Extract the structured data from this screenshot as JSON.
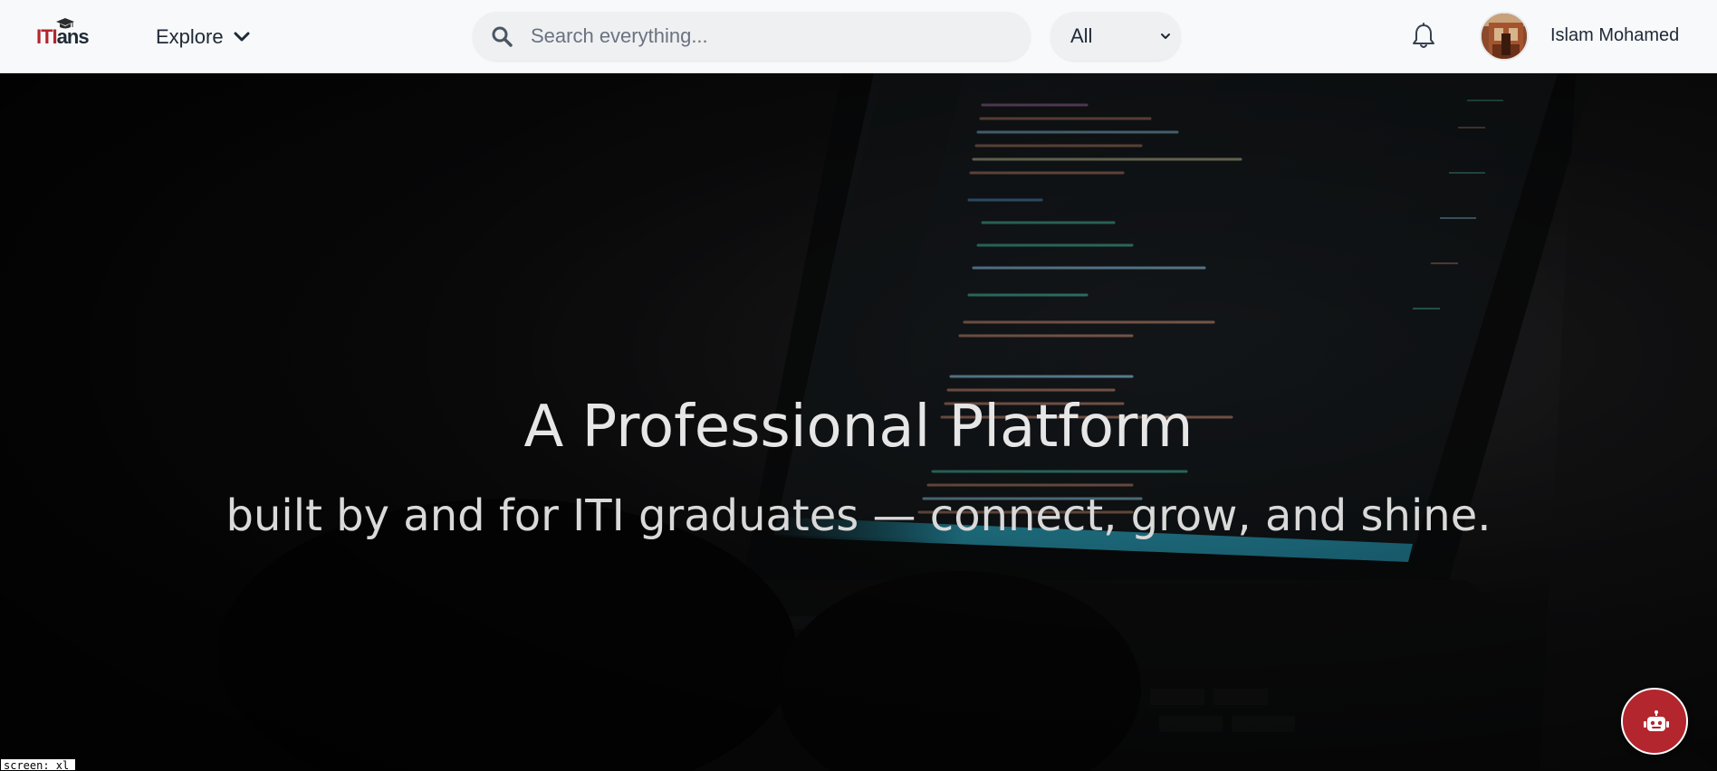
{
  "brand": {
    "logo_text_1": "ITI",
    "logo_text_2": "ans",
    "logo_name": "ITIans"
  },
  "nav": {
    "explore_label": "Explore"
  },
  "search": {
    "placeholder": "Search everything...",
    "value": ""
  },
  "scope": {
    "selected": "All"
  },
  "user": {
    "name": "Islam Mohamed"
  },
  "hero": {
    "title": "A Professional Platform",
    "subtitle": "built by and for ITI graduates — connect, grow, and shine."
  },
  "debug": {
    "screen_label": "screen: xl"
  },
  "colors": {
    "brand_red": "#b3262d",
    "header_bg": "#f8f9fa",
    "text_dark": "#1f2937"
  },
  "icons": [
    "graduation-cap-icon",
    "chevron-down-icon",
    "search-icon",
    "bell-icon",
    "robot-icon"
  ]
}
